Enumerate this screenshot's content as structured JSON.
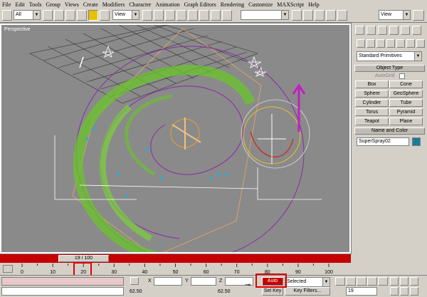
{
  "menu": [
    "File",
    "Edit",
    "Tools",
    "Group",
    "Views",
    "Create",
    "Modifiers",
    "Character",
    "Animation",
    "Graph Editors",
    "Rendering",
    "Customize",
    "MAXScript",
    "Help"
  ],
  "toolbar": {
    "selection_filter": "All",
    "ref_coord": "View",
    "ref_coord_right": "View"
  },
  "viewport": {
    "label": "Perspective"
  },
  "panel": {
    "category": "Standard Primitives",
    "object_type_header": "Object Type",
    "autogrid_label": "AutoGrid",
    "buttons": [
      "Box",
      "Cone",
      "Sphere",
      "GeoSphere",
      "Cylinder",
      "Tube",
      "Torus",
      "Pyramid",
      "Teapot",
      "Plane"
    ],
    "name_color_header": "Name and Color",
    "object_name": "SuperSpray02",
    "object_color": "#1a7a9a"
  },
  "timeline": {
    "slider": "19 / 100",
    "ticks": [
      "0",
      "10",
      "20",
      "30",
      "40",
      "50",
      "60",
      "70",
      "80",
      "90",
      "100"
    ]
  },
  "status": {
    "x_label": "X",
    "y_label": "Y",
    "z_label": "Z",
    "left_value": "62.50",
    "mid_value": "62.50",
    "auto_key": "Auto Key",
    "key_mode": "Selected",
    "set_key": "Set Key",
    "key_filters": "Key Filters...",
    "frame": "19"
  },
  "colors": {
    "viewport_bg": "#8a8a8a",
    "track": "#c40000",
    "autokey": "#c40000",
    "highlight": "#e00000"
  }
}
